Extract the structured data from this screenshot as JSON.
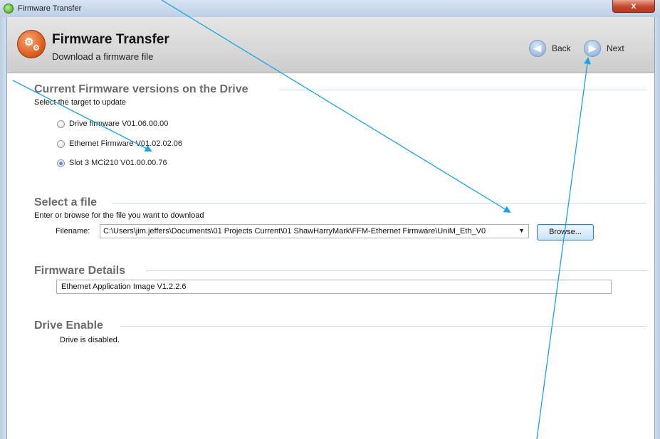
{
  "window": {
    "title": "Firmware Transfer",
    "close_glyph": "x"
  },
  "header": {
    "title": "Firmware Transfer",
    "subtitle": "Download a firmware file",
    "back_label": "Back",
    "next_label": "Next",
    "logo_icon": "gears-icon"
  },
  "firmware_versions": {
    "heading": "Current Firmware versions on the Drive",
    "hint": "Select the target to update",
    "options": [
      {
        "label": "Drive firmware  V01.06.00.00",
        "checked": false
      },
      {
        "label": "Ethernet Firmware  V01.02.02.06",
        "checked": false
      },
      {
        "label": "Slot 3  MCi210   V01.00.00.76",
        "checked": true
      }
    ]
  },
  "select_file": {
    "heading": "Select a file",
    "hint": "Enter or browse for the file you want to download",
    "filename_label": "Filename:",
    "filename_value": "C:\\Users\\jim.jeffers\\Documents\\01 Projects Current\\01 ShawHarryMark\\FFM-Ethernet Firmware\\UniM_Eth_V0",
    "browse_label": "Browse..."
  },
  "firmware_details": {
    "heading": "Firmware Details",
    "value": "Ethernet Application Image V1.2.2.6"
  },
  "drive_enable": {
    "heading": "Drive Enable",
    "status": "Drive is disabled."
  },
  "colors": {
    "accent_blue": "#1aa3e6",
    "logo_orange": "#e0601d",
    "section_heading": "#6b6b6b"
  }
}
